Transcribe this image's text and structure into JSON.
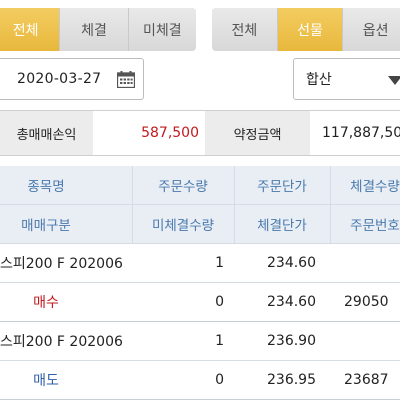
{
  "left_tabs": [
    {
      "label": "전체",
      "active": true
    },
    {
      "label": "체결",
      "active": false
    },
    {
      "label": "미체결",
      "active": false
    }
  ],
  "right_tabs": [
    {
      "label": "전체",
      "active": false
    },
    {
      "label": "선물",
      "active": true
    },
    {
      "label": "옵션",
      "active": false
    }
  ],
  "date": {
    "value": "2020-03-27",
    "icon": "calendar-icon"
  },
  "filter": {
    "selected": "합산",
    "icon": "dropdown-arrow-icon"
  },
  "summary": {
    "total_pl_label": "총매매손익",
    "total_pl_value": "587,500",
    "contract_amount_label": "약정금액",
    "contract_amount_value": "117,887,50"
  },
  "grid": {
    "header1": [
      "종목명",
      "주문수량",
      "주문단가",
      "체결수량"
    ],
    "header2": [
      "매매구분",
      "미체결수량",
      "체결단가",
      "주문번호"
    ],
    "orders": [
      {
        "name": "스피200 F 202006",
        "order_qty": "1",
        "order_price": "234.60",
        "filled_qty": "",
        "side": "매수",
        "unfilled_qty": "0",
        "fill_price": "234.60",
        "order_no": "29050"
      },
      {
        "name": "스피200 F 202006",
        "order_qty": "1",
        "order_price": "236.90",
        "filled_qty": "",
        "side": "매도",
        "unfilled_qty": "0",
        "fill_price": "236.95",
        "order_no": "23687"
      }
    ]
  },
  "colors": {
    "active_tab": "#ebbc45",
    "buy": "#c2191f",
    "sell": "#2f5fa8",
    "header_bg": "#e9eef5",
    "header_text": "#4a79ad"
  }
}
